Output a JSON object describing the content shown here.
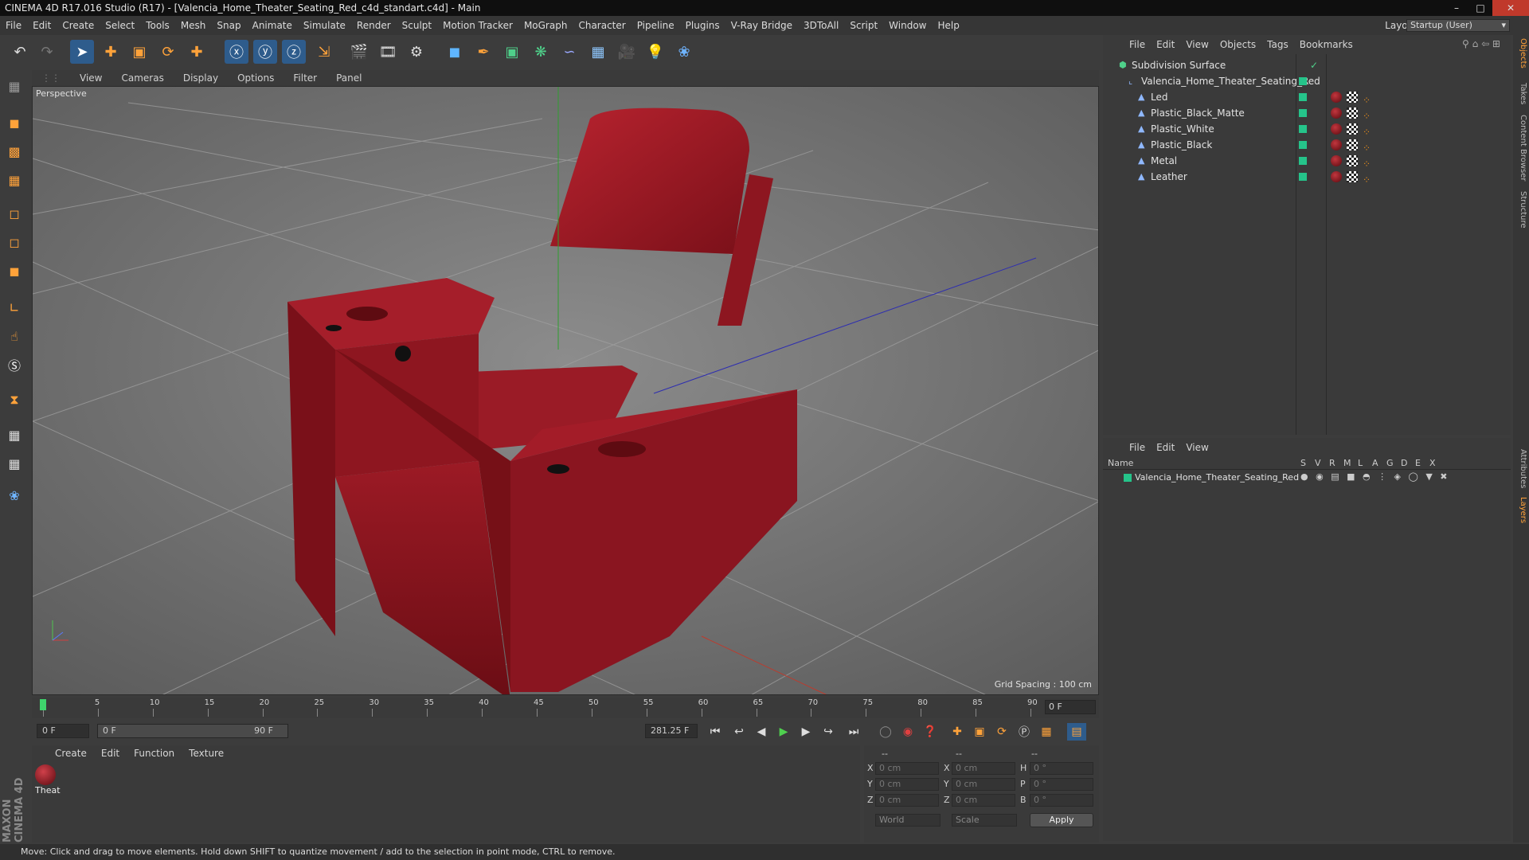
{
  "window": {
    "title": "CINEMA 4D R17.016 Studio (R17) - [Valencia_Home_Theater_Seating_Red_c4d_standart.c4d] - Main"
  },
  "menubar": {
    "items": [
      "File",
      "Edit",
      "Create",
      "Select",
      "Tools",
      "Mesh",
      "Snap",
      "Animate",
      "Simulate",
      "Render",
      "Sculpt",
      "Motion Tracker",
      "MoGraph",
      "Character",
      "Pipeline",
      "Plugins",
      "V-Ray Bridge",
      "3DToAll",
      "Script",
      "Window",
      "Help"
    ],
    "layout_label": "Layout:",
    "layout_value": "Startup (User)"
  },
  "toolbar": {
    "icons": [
      "undo-icon",
      "redo-icon",
      "select-cursor-icon",
      "move-icon",
      "scale-icon",
      "rotate-icon",
      "transform-icon",
      "x-axis-icon",
      "y-axis-icon",
      "z-axis-icon",
      "coordinate-system-icon",
      "render-view-icon",
      "render-picture-viewer-icon",
      "render-settings-icon",
      "cube-icon",
      "spline-pen-icon",
      "subdivision-icon",
      "mograph-cloner-icon",
      "deformer-icon",
      "floor-icon",
      "camera-icon",
      "light-icon",
      "python-icon"
    ]
  },
  "viewport": {
    "menu": [
      "View",
      "Cameras",
      "Display",
      "Options",
      "Filter",
      "Panel"
    ],
    "label": "Perspective",
    "grid_spacing": "Grid Spacing : 100 cm"
  },
  "timeline": {
    "ticks": [
      "0",
      "5",
      "10",
      "15",
      "20",
      "25",
      "30",
      "35",
      "40",
      "45",
      "50",
      "55",
      "60",
      "65",
      "70",
      "75",
      "80",
      "85",
      "90"
    ],
    "current_frame": "0 F",
    "start_field": "0 F",
    "range_start": "0 F",
    "range_end": "90 F",
    "fps_field": "281.25 F"
  },
  "material_panel": {
    "menu": [
      "Create",
      "Edit",
      "Function",
      "Texture"
    ],
    "materials": [
      {
        "name": "Theat",
        "color": "#8b1520"
      }
    ]
  },
  "coordinates": {
    "headers": [
      "--",
      "--",
      "--"
    ],
    "rows": [
      {
        "a": "X",
        "av": "0 cm",
        "b": "X",
        "bv": "0 cm",
        "c": "H",
        "cv": "0 °"
      },
      {
        "a": "Y",
        "av": "0 cm",
        "b": "Y",
        "bv": "0 cm",
        "c": "P",
        "cv": "0 °"
      },
      {
        "a": "Z",
        "av": "0 cm",
        "b": "Z",
        "bv": "0 cm",
        "c": "B",
        "cv": "0 °"
      }
    ],
    "world": "World",
    "scale": "Scale",
    "apply": "Apply"
  },
  "object_manager": {
    "menu": [
      "File",
      "Edit",
      "View",
      "Objects",
      "Tags",
      "Bookmarks"
    ],
    "objects": [
      {
        "name": "Subdivision Surface",
        "level": 0
      },
      {
        "name": "Valencia_Home_Theater_Seating_Red",
        "level": 1
      },
      {
        "name": "Led",
        "level": 2
      },
      {
        "name": "Plastic_Black_Matte",
        "level": 2
      },
      {
        "name": "Plastic_White",
        "level": 2
      },
      {
        "name": "Plastic_Black",
        "level": 2
      },
      {
        "name": "Metal",
        "level": 2
      },
      {
        "name": "Leather",
        "level": 2
      }
    ]
  },
  "layer_manager": {
    "menu": [
      "File",
      "Edit",
      "View"
    ],
    "columns": [
      "Name",
      "S",
      "V",
      "R",
      "M",
      "L",
      "A",
      "G",
      "D",
      "E",
      "X"
    ],
    "layers": [
      {
        "name": "Valencia_Home_Theater_Seating_Red",
        "color": "#25c48a"
      }
    ]
  },
  "side_tabs": [
    "Objects",
    "Takes",
    "Content Browser",
    "Structure",
    "Attributes",
    "Layers"
  ],
  "status": "Move: Click and drag to move elements. Hold down SHIFT to quantize movement / add to the selection in point mode, CTRL to remove.",
  "brand": "MAXON CINEMA 4D",
  "colors": {
    "accent": "#2e5c8c",
    "object_visible": "#25c48a",
    "chair": "#8b1520"
  }
}
